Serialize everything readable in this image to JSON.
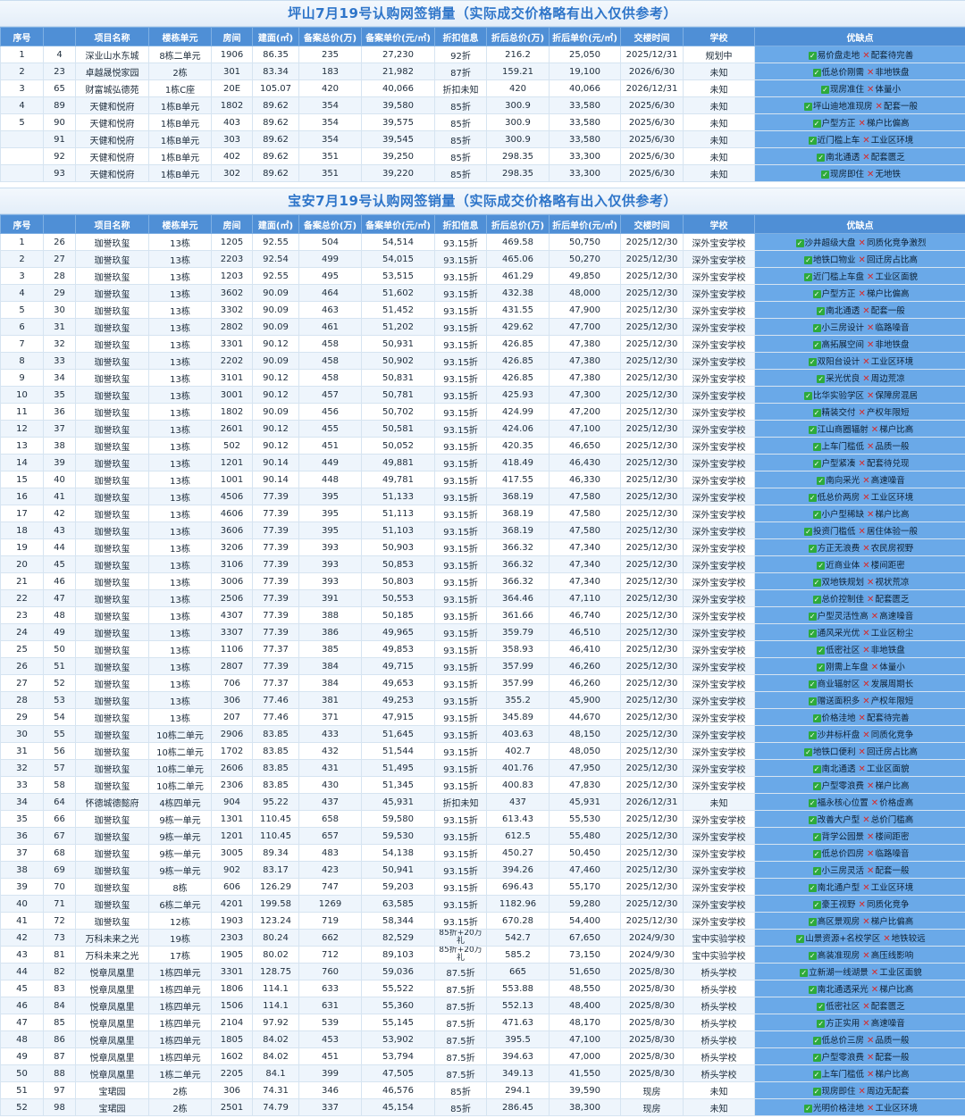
{
  "columns": [
    "序号",
    "",
    "项目名称",
    "楼栋单元",
    "房间",
    "建面(㎡)",
    "备案总价(万)",
    "备案单价(元/㎡)",
    "折扣信息",
    "折后总价(万)",
    "折后单价(元/㎡)",
    "交楼时间",
    "学校",
    "优缺点"
  ],
  "section1": {
    "title": "坪山7月19号认购网签销量（实际成交价格略有出入仅供参考）",
    "rows": [
      [
        "1",
        "4",
        "深业山水东城",
        "8栋二单元",
        "1906",
        "86.35",
        "235",
        "27,230",
        "92折",
        "216.2",
        "25,050",
        "2025/12/31",
        "规划中",
        "易价盘走地",
        "配套待完善"
      ],
      [
        "2",
        "23",
        "卓越晟悦家园",
        "2栋",
        "301",
        "83.34",
        "183",
        "21,982",
        "87折",
        "159.21",
        "19,100",
        "2026/6/30",
        "未知",
        "低总价刚需",
        "非地铁盘"
      ],
      [
        "3",
        "65",
        "财富城弘德苑",
        "1栋C座",
        "20E",
        "105.07",
        "420",
        "40,066",
        "折扣未知",
        "420",
        "40,066",
        "2026/12/31",
        "未知",
        "现房准住",
        "体量小"
      ],
      [
        "4",
        "89",
        "天健和悦府",
        "1栋B单元",
        "1802",
        "89.62",
        "354",
        "39,580",
        "85折",
        "300.9",
        "33,580",
        "2025/6/30",
        "未知",
        "坪山迪地准现房",
        "配套一般"
      ],
      [
        "5",
        "90",
        "天健和悦府",
        "1栋B单元",
        "403",
        "89.62",
        "354",
        "39,575",
        "85折",
        "300.9",
        "33,580",
        "2025/6/30",
        "未知",
        "户型方正",
        "梯户比偏高"
      ],
      [
        "",
        "91",
        "天健和悦府",
        "1栋B单元",
        "303",
        "89.62",
        "354",
        "39,545",
        "85折",
        "300.9",
        "33,580",
        "2025/6/30",
        "未知",
        "近门槛上车",
        "工业区环境"
      ],
      [
        "",
        "92",
        "天健和悦府",
        "1栋B单元",
        "402",
        "89.62",
        "351",
        "39,250",
        "85折",
        "298.35",
        "33,300",
        "2025/6/30",
        "未知",
        "南北通透",
        "配套匮乏"
      ],
      [
        "",
        "93",
        "天健和悦府",
        "1栋B单元",
        "302",
        "89.62",
        "351",
        "39,220",
        "85折",
        "298.35",
        "33,300",
        "2025/6/30",
        "未知",
        "现房即住",
        "无地铁"
      ]
    ]
  },
  "section2": {
    "title": "宝安7月19号认购网签销量（实际成交价格略有出入仅供参考）",
    "rows": [
      [
        "1",
        "26",
        "珈誉玖玺",
        "13栋",
        "1205",
        "92.55",
        "504",
        "54,514",
        "93.15折",
        "469.58",
        "50,750",
        "2025/12/30",
        "深外宝安学校",
        "沙井超级大盘",
        "同质化竞争激烈"
      ],
      [
        "2",
        "27",
        "珈誉玖玺",
        "13栋",
        "2203",
        "92.54",
        "499",
        "54,015",
        "93.15折",
        "465.06",
        "50,270",
        "2025/12/30",
        "深外宝安学校",
        "地铁口物业",
        "回迁房占比高"
      ],
      [
        "3",
        "28",
        "珈誉玖玺",
        "13栋",
        "1203",
        "92.55",
        "495",
        "53,515",
        "93.15折",
        "461.29",
        "49,850",
        "2025/12/30",
        "深外宝安学校",
        "近门槛上车盘",
        "工业区面貌"
      ],
      [
        "4",
        "29",
        "珈誉玖玺",
        "13栋",
        "3602",
        "90.09",
        "464",
        "51,602",
        "93.15折",
        "432.38",
        "48,000",
        "2025/12/30",
        "深外宝安学校",
        "户型方正",
        "梯户比偏高"
      ],
      [
        "5",
        "30",
        "珈誉玖玺",
        "13栋",
        "3302",
        "90.09",
        "463",
        "51,452",
        "93.15折",
        "431.55",
        "47,900",
        "2025/12/30",
        "深外宝安学校",
        "南北通透",
        "配套一般"
      ],
      [
        "6",
        "31",
        "珈誉玖玺",
        "13栋",
        "2802",
        "90.09",
        "461",
        "51,202",
        "93.15折",
        "429.62",
        "47,700",
        "2025/12/30",
        "深外宝安学校",
        "小三房设计",
        "临路噪音"
      ],
      [
        "7",
        "32",
        "珈誉玖玺",
        "13栋",
        "3301",
        "90.12",
        "458",
        "50,931",
        "93.15折",
        "426.85",
        "47,380",
        "2025/12/30",
        "深外宝安学校",
        "高拓展空间",
        "非地铁盘"
      ],
      [
        "8",
        "33",
        "珈誉玖玺",
        "13栋",
        "2202",
        "90.09",
        "458",
        "50,902",
        "93.15折",
        "426.85",
        "47,380",
        "2025/12/30",
        "深外宝安学校",
        "双阳台设计",
        "工业区环境"
      ],
      [
        "9",
        "34",
        "珈誉玖玺",
        "13栋",
        "3101",
        "90.12",
        "458",
        "50,831",
        "93.15折",
        "426.85",
        "47,380",
        "2025/12/30",
        "深外宝安学校",
        "采光优良",
        "周边荒凉"
      ],
      [
        "10",
        "35",
        "珈誉玖玺",
        "13栋",
        "3001",
        "90.12",
        "457",
        "50,781",
        "93.15折",
        "425.93",
        "47,300",
        "2025/12/30",
        "深外宝安学校",
        "比华实验学区",
        "保障房混居"
      ],
      [
        "11",
        "36",
        "珈誉玖玺",
        "13栋",
        "1802",
        "90.09",
        "456",
        "50,702",
        "93.15折",
        "424.99",
        "47,200",
        "2025/12/30",
        "深外宝安学校",
        "精装交付",
        "产权年限短"
      ],
      [
        "12",
        "37",
        "珈誉玖玺",
        "13栋",
        "2601",
        "90.12",
        "455",
        "50,581",
        "93.15折",
        "424.06",
        "47,100",
        "2025/12/30",
        "深外宝安学校",
        "江山商圈辐射",
        "梯户比高"
      ],
      [
        "13",
        "38",
        "珈誉玖玺",
        "13栋",
        "502",
        "90.12",
        "451",
        "50,052",
        "93.15折",
        "420.35",
        "46,650",
        "2025/12/30",
        "深外宝安学校",
        "上车门槛低",
        "品质一般"
      ],
      [
        "14",
        "39",
        "珈誉玖玺",
        "13栋",
        "1201",
        "90.14",
        "449",
        "49,881",
        "93.15折",
        "418.49",
        "46,430",
        "2025/12/30",
        "深外宝安学校",
        "户型紧凑",
        "配套待兑现"
      ],
      [
        "15",
        "40",
        "珈誉玖玺",
        "13栋",
        "1001",
        "90.14",
        "448",
        "49,781",
        "93.15折",
        "417.55",
        "46,330",
        "2025/12/30",
        "深外宝安学校",
        "南向采光",
        "高速噪音"
      ],
      [
        "16",
        "41",
        "珈誉玖玺",
        "13栋",
        "4506",
        "77.39",
        "395",
        "51,133",
        "93.15折",
        "368.19",
        "47,580",
        "2025/12/30",
        "深外宝安学校",
        "低总价两房",
        "工业区环境"
      ],
      [
        "17",
        "42",
        "珈誉玖玺",
        "13栋",
        "4606",
        "77.39",
        "395",
        "51,113",
        "93.15折",
        "368.19",
        "47,580",
        "2025/12/30",
        "深外宝安学校",
        "小户型稀缺",
        "梯户比高"
      ],
      [
        "18",
        "43",
        "珈誉玖玺",
        "13栋",
        "3606",
        "77.39",
        "395",
        "51,103",
        "93.15折",
        "368.19",
        "47,580",
        "2025/12/30",
        "深外宝安学校",
        "投资门槛低",
        "居住体验一般"
      ],
      [
        "19",
        "44",
        "珈誉玖玺",
        "13栋",
        "3206",
        "77.39",
        "393",
        "50,903",
        "93.15折",
        "366.32",
        "47,340",
        "2025/12/30",
        "深外宝安学校",
        "方正无浪费",
        "农民房视野"
      ],
      [
        "20",
        "45",
        "珈誉玖玺",
        "13栋",
        "3106",
        "77.39",
        "393",
        "50,853",
        "93.15折",
        "366.32",
        "47,340",
        "2025/12/30",
        "深外宝安学校",
        "近商业体",
        "楼间距密"
      ],
      [
        "21",
        "46",
        "珈誉玖玺",
        "13栋",
        "3006",
        "77.39",
        "393",
        "50,803",
        "93.15折",
        "366.32",
        "47,340",
        "2025/12/30",
        "深外宝安学校",
        "双地铁规划",
        "视状荒凉"
      ],
      [
        "22",
        "47",
        "珈誉玖玺",
        "13栋",
        "2506",
        "77.39",
        "391",
        "50,553",
        "93.15折",
        "364.46",
        "47,110",
        "2025/12/30",
        "深外宝安学校",
        "总价控制佳",
        "配套匮乏"
      ],
      [
        "23",
        "48",
        "珈誉玖玺",
        "13栋",
        "4307",
        "77.39",
        "388",
        "50,185",
        "93.15折",
        "361.66",
        "46,740",
        "2025/12/30",
        "深外宝安学校",
        "户型灵活性高",
        "高速噪音"
      ],
      [
        "24",
        "49",
        "珈誉玖玺",
        "13栋",
        "3307",
        "77.39",
        "386",
        "49,965",
        "93.15折",
        "359.79",
        "46,510",
        "2025/12/30",
        "深外宝安学校",
        "通风采光优",
        "工业区粉尘"
      ],
      [
        "25",
        "50",
        "珈誉玖玺",
        "13栋",
        "1106",
        "77.37",
        "385",
        "49,853",
        "93.15折",
        "358.93",
        "46,410",
        "2025/12/30",
        "深外宝安学校",
        "低密社区",
        "非地铁盘"
      ],
      [
        "26",
        "51",
        "珈誉玖玺",
        "13栋",
        "2807",
        "77.39",
        "384",
        "49,715",
        "93.15折",
        "357.99",
        "46,260",
        "2025/12/30",
        "深外宝安学校",
        "刚需上车盘",
        "体量小"
      ],
      [
        "27",
        "52",
        "珈誉玖玺",
        "13栋",
        "706",
        "77.37",
        "384",
        "49,653",
        "93.15折",
        "357.99",
        "46,260",
        "2025/12/30",
        "深外宝安学校",
        "商业辐射区",
        "发展周期长"
      ],
      [
        "28",
        "53",
        "珈誉玖玺",
        "13栋",
        "306",
        "77.46",
        "381",
        "49,253",
        "93.15折",
        "355.2",
        "45,900",
        "2025/12/30",
        "深外宝安学校",
        "赠送面积多",
        "产权年限短"
      ],
      [
        "29",
        "54",
        "珈誉玖玺",
        "13栋",
        "207",
        "77.46",
        "371",
        "47,915",
        "93.15折",
        "345.89",
        "44,670",
        "2025/12/30",
        "深外宝安学校",
        "价格洼地",
        "配套待完善"
      ],
      [
        "30",
        "55",
        "珈誉玖玺",
        "10栋二单元",
        "2906",
        "83.85",
        "433",
        "51,645",
        "93.15折",
        "403.63",
        "48,150",
        "2025/12/30",
        "深外宝安学校",
        "沙井标杆盘",
        "同质化竞争"
      ],
      [
        "31",
        "56",
        "珈誉玖玺",
        "10栋二单元",
        "1702",
        "83.85",
        "432",
        "51,544",
        "93.15折",
        "402.7",
        "48,050",
        "2025/12/30",
        "深外宝安学校",
        "地铁口便利",
        "回迁房占比高"
      ],
      [
        "32",
        "57",
        "珈誉玖玺",
        "10栋二单元",
        "2606",
        "83.85",
        "431",
        "51,495",
        "93.15折",
        "401.76",
        "47,950",
        "2025/12/30",
        "深外宝安学校",
        "南北通透",
        "工业区面貌"
      ],
      [
        "33",
        "58",
        "珈誉玖玺",
        "10栋二单元",
        "2306",
        "83.85",
        "430",
        "51,345",
        "93.15折",
        "400.83",
        "47,830",
        "2025/12/30",
        "深外宝安学校",
        "户型零浪费",
        "梯户比高"
      ],
      [
        "34",
        "64",
        "怀德城德懿府",
        "4栋四单元",
        "904",
        "95.22",
        "437",
        "45,931",
        "折扣未知",
        "437",
        "45,931",
        "2026/12/31",
        "未知",
        "福永核心位置",
        "价格虚高"
      ],
      [
        "35",
        "66",
        "珈誉玖玺",
        "9栋一单元",
        "1301",
        "110.45",
        "658",
        "59,580",
        "93.15折",
        "613.43",
        "55,530",
        "2025/12/30",
        "深外宝安学校",
        "改善大户型",
        "总价门槛高"
      ],
      [
        "36",
        "67",
        "珈誉玖玺",
        "9栋一单元",
        "1201",
        "110.45",
        "657",
        "59,530",
        "93.15折",
        "612.5",
        "55,480",
        "2025/12/30",
        "深外宝安学校",
        "背学公园景",
        "楼间距密"
      ],
      [
        "37",
        "68",
        "珈誉玖玺",
        "9栋一单元",
        "3005",
        "89.34",
        "483",
        "54,138",
        "93.15折",
        "450.27",
        "50,450",
        "2025/12/30",
        "深外宝安学校",
        "低总价四房",
        "临路噪音"
      ],
      [
        "38",
        "69",
        "珈誉玖玺",
        "9栋一单元",
        "902",
        "83.17",
        "423",
        "50,941",
        "93.15折",
        "394.26",
        "47,460",
        "2025/12/30",
        "深外宝安学校",
        "小三房灵活",
        "配套一般"
      ],
      [
        "39",
        "70",
        "珈誉玖玺",
        "8栋",
        "606",
        "126.29",
        "747",
        "59,203",
        "93.15折",
        "696.43",
        "55,170",
        "2025/12/30",
        "深外宝安学校",
        "南北通户型",
        "工业区环境"
      ],
      [
        "40",
        "71",
        "珈誉玖玺",
        "6栋二单元",
        "4201",
        "199.58",
        "1269",
        "63,585",
        "93.15折",
        "1182.96",
        "59,280",
        "2025/12/30",
        "深外宝安学校",
        "豪王视野",
        "同质化竞争"
      ],
      [
        "41",
        "72",
        "珈誉玖玺",
        "12栋",
        "1903",
        "123.24",
        "719",
        "58,344",
        "93.15折",
        "670.28",
        "54,400",
        "2025/12/30",
        "深外宝安学校",
        "高区景观房",
        "梯户比偏高"
      ],
      [
        "42",
        "73",
        "万科未来之光",
        "19栋",
        "2303",
        "80.24",
        "662",
        "82,529",
        "85折+20万礼",
        "542.7",
        "67,650",
        "2024/9/30",
        "宝中实验学校",
        "山景资源+名校学区",
        "地铁较远"
      ],
      [
        "43",
        "81",
        "万科未来之光",
        "17栋",
        "1905",
        "80.02",
        "712",
        "89,103",
        "85折+20万礼",
        "585.2",
        "73,150",
        "2024/9/30",
        "宝中实验学校",
        "高装准现房",
        "高压线影响"
      ],
      [
        "44",
        "82",
        "悦章凤凰里",
        "1栋四单元",
        "3301",
        "128.75",
        "760",
        "59,036",
        "87.5折",
        "665",
        "51,650",
        "2025/8/30",
        "桥头学校",
        "立新湖一线湖景",
        "工业区面貌"
      ],
      [
        "45",
        "83",
        "悦章凤凰里",
        "1栋四单元",
        "1806",
        "114.1",
        "633",
        "55,522",
        "87.5折",
        "553.88",
        "48,550",
        "2025/8/30",
        "桥头学校",
        "南北通透采光",
        "梯户比高"
      ],
      [
        "46",
        "84",
        "悦章凤凰里",
        "1栋四单元",
        "1506",
        "114.1",
        "631",
        "55,360",
        "87.5折",
        "552.13",
        "48,400",
        "2025/8/30",
        "桥头学校",
        "低密社区",
        "配套匮乏"
      ],
      [
        "47",
        "85",
        "悦章凤凰里",
        "1栋四单元",
        "2104",
        "97.92",
        "539",
        "55,145",
        "87.5折",
        "471.63",
        "48,170",
        "2025/8/30",
        "桥头学校",
        "方正实用",
        "高速噪音"
      ],
      [
        "48",
        "86",
        "悦章凤凰里",
        "1栋四单元",
        "1805",
        "84.02",
        "453",
        "53,902",
        "87.5折",
        "395.5",
        "47,100",
        "2025/8/30",
        "桥头学校",
        "低总价三房",
        "品质一般"
      ],
      [
        "49",
        "87",
        "悦章凤凰里",
        "1栋四单元",
        "1602",
        "84.02",
        "451",
        "53,794",
        "87.5折",
        "394.63",
        "47,000",
        "2025/8/30",
        "桥头学校",
        "户型零浪费",
        "配套一般"
      ],
      [
        "50",
        "88",
        "悦章凤凰里",
        "1栋二单元",
        "2205",
        "84.1",
        "399",
        "47,505",
        "87.5折",
        "349.13",
        "41,550",
        "2025/8/30",
        "桥头学校",
        "上车门槛低",
        "梯户比高"
      ],
      [
        "51",
        "97",
        "宝珺园",
        "2栋",
        "306",
        "74.31",
        "346",
        "46,576",
        "85折",
        "294.1",
        "39,590",
        "现房",
        "未知",
        "现房即住",
        "周边无配套"
      ],
      [
        "52",
        "98",
        "宝珺园",
        "2栋",
        "2501",
        "74.79",
        "337",
        "45,154",
        "85折",
        "286.45",
        "38,300",
        "现房",
        "未知",
        "光明价格洼地",
        "工业区环境"
      ]
    ]
  },
  "icons": {
    "pro": "check-mark",
    "con": "cross-mark"
  },
  "colors": {
    "header": "#4f8fd6",
    "title_text": "#2e75c9",
    "advantage_cell": "#6aa9e8",
    "check": "#2eaa3c",
    "cross": "#d62b2b"
  }
}
